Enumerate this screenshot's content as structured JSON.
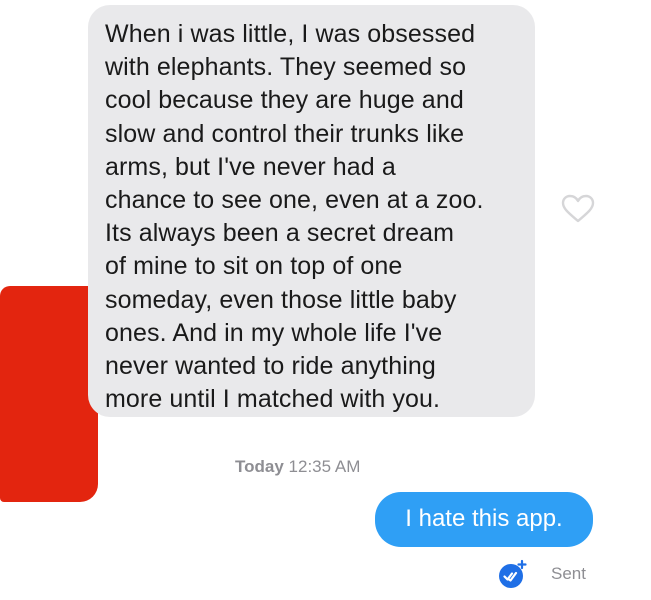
{
  "conversation": {
    "incoming_message": "When i was little, I was obsessed\nwith elephants. They seemed so\ncool because they are huge and\nslow and control their trunks like\narms, but I've never had a\nchance to see one, even at a zoo.\nIts always been a secret dream\nof mine to sit on top of one\nsomeday, even those little baby\nones. And in my whole life I've\nnever wanted to ride anything\nmore until I matched with you.",
    "timestamp_day": "Today",
    "timestamp_time": "12:35 AM",
    "outgoing_message": "I hate this app.",
    "status_label": "Sent"
  },
  "icons": {
    "like": "heart-outline-icon",
    "delivery": "check-badge-icon"
  },
  "colors": {
    "incoming_bubble": "#e9e9eb",
    "outgoing_bubble": "#2f9ff5",
    "meta_text": "#8e8e93",
    "redaction": "#e3250f"
  }
}
